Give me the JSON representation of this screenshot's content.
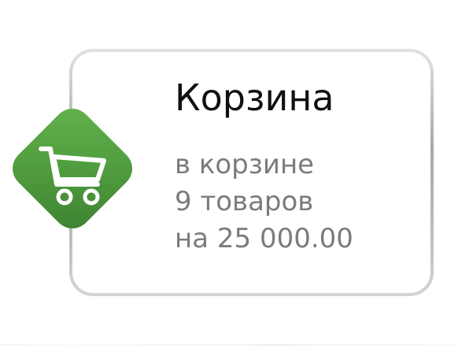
{
  "cart": {
    "title": "Корзина",
    "line1": "в корзине",
    "line2": "9 товаров",
    "line3": "на 25 000.00",
    "icon": "shopping-cart-icon",
    "accent_color": "#4e9a3d",
    "text_color": "#7b7b7b"
  }
}
